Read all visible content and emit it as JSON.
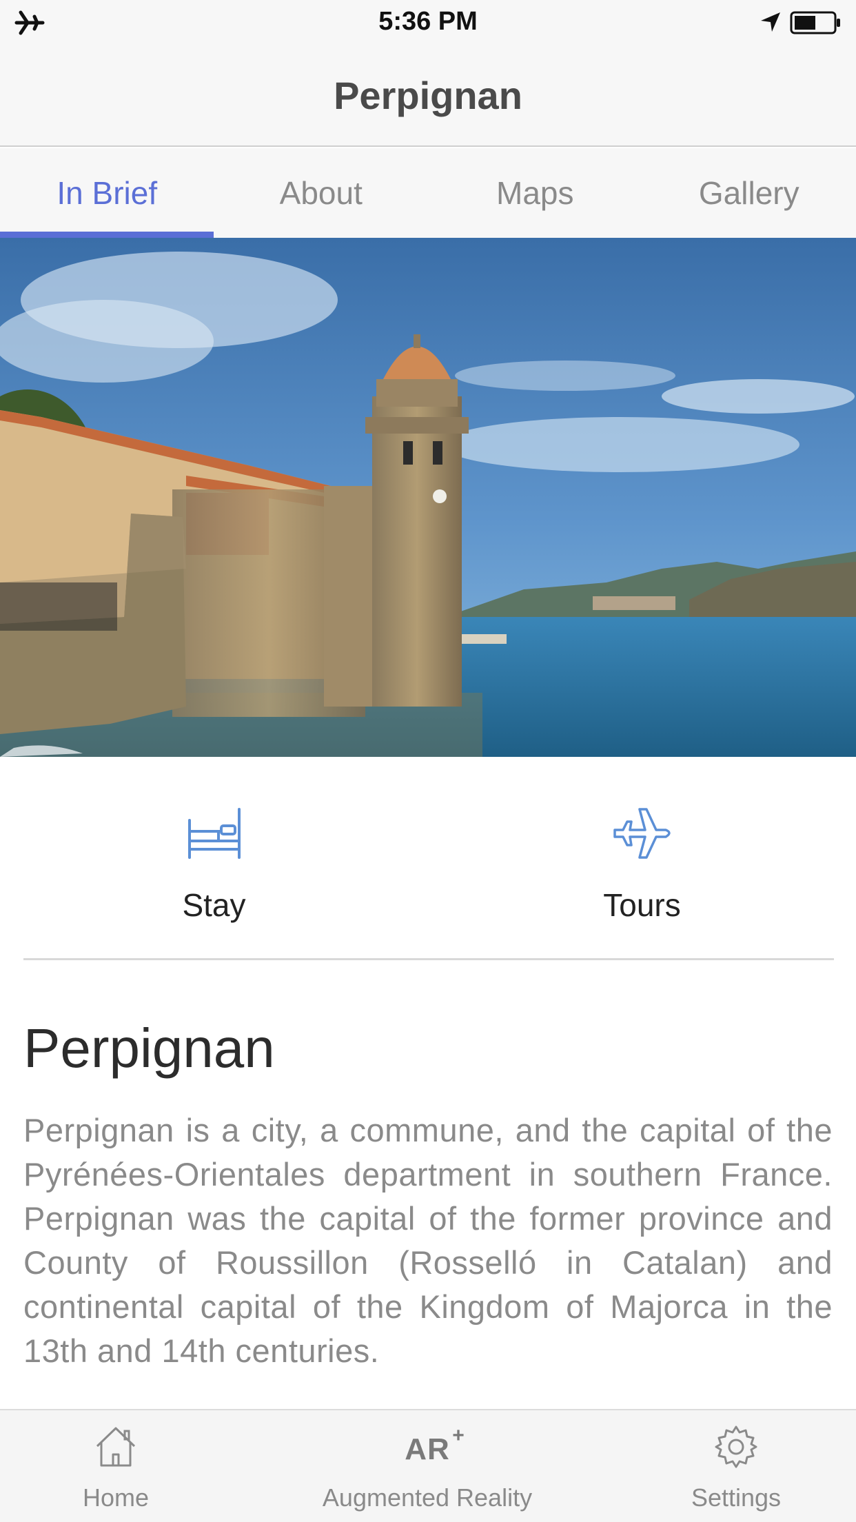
{
  "status_bar": {
    "time": "5:36 PM",
    "left_icon": "airplane-icon",
    "right_icons": [
      "location-arrow-icon",
      "battery-icon"
    ]
  },
  "nav": {
    "title": "Perpignan"
  },
  "tabs": [
    {
      "label": "In Brief",
      "active": true
    },
    {
      "label": "About",
      "active": false
    },
    {
      "label": "Maps",
      "active": false
    },
    {
      "label": "Gallery",
      "active": false
    }
  ],
  "accent_color": "#5b6fd6",
  "hero": {
    "description": "Collioure coastline with stone bell tower, fortress walls and blue sea"
  },
  "actions": [
    {
      "label": "Stay",
      "icon": "bed-icon"
    },
    {
      "label": "Tours",
      "icon": "airplane-icon"
    }
  ],
  "content": {
    "title": "Perpignan",
    "body": "Perpignan is a city, a commune, and the capital of the Pyrénées-Orientales department in southern France. Perpignan was the capital of the former province and County of Roussillon (Rosselló in Catalan) and continental capital of the Kingdom of Majorca in the 13th and 14th centuries."
  },
  "tab_bar": [
    {
      "label": "Home",
      "icon": "home-icon"
    },
    {
      "label": "Augmented Reality",
      "icon": "ar-icon",
      "icon_text": "AR",
      "icon_sup": "+"
    },
    {
      "label": "Settings",
      "icon": "gear-icon"
    }
  ]
}
